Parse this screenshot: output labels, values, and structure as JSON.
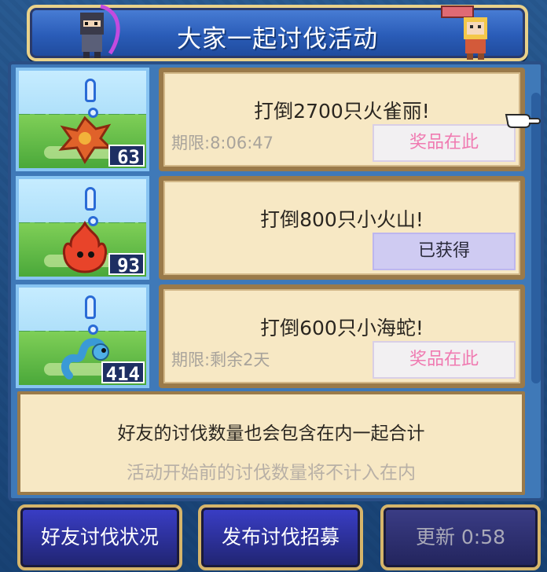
{
  "header": {
    "title": "大家一起讨伐活动"
  },
  "missions": [
    {
      "title": "打倒2700只火雀丽!",
      "deadline": "期限:8:06:47",
      "button": "奖品在此",
      "button_state": "reward",
      "count": "63",
      "monster_icon": "fire-bird-icon"
    },
    {
      "title": "打倒800只小火山!",
      "deadline": "",
      "button": "已获得",
      "button_state": "claimed",
      "count": "93",
      "monster_icon": "fire-spirit-icon"
    },
    {
      "title": "打倒600只小海蛇!",
      "deadline": "期限:剩余2天",
      "button": "奖品在此",
      "button_state": "reward",
      "count": "414",
      "monster_icon": "sea-serpent-icon"
    }
  ],
  "note": {
    "line1": "好友的讨伐数量也会包含在内一起合计",
    "line2": "活动开始前的讨伐数量将不计入在内"
  },
  "buttons": {
    "friend_status": "好友讨伐状况",
    "publish_recruit": "发布讨伐招募",
    "refresh": "更新 0:58"
  },
  "colors": {
    "reward_text": "#f07ab1",
    "panel_bg": "#f7e8c4",
    "header_blue": "#2a5cb8"
  }
}
